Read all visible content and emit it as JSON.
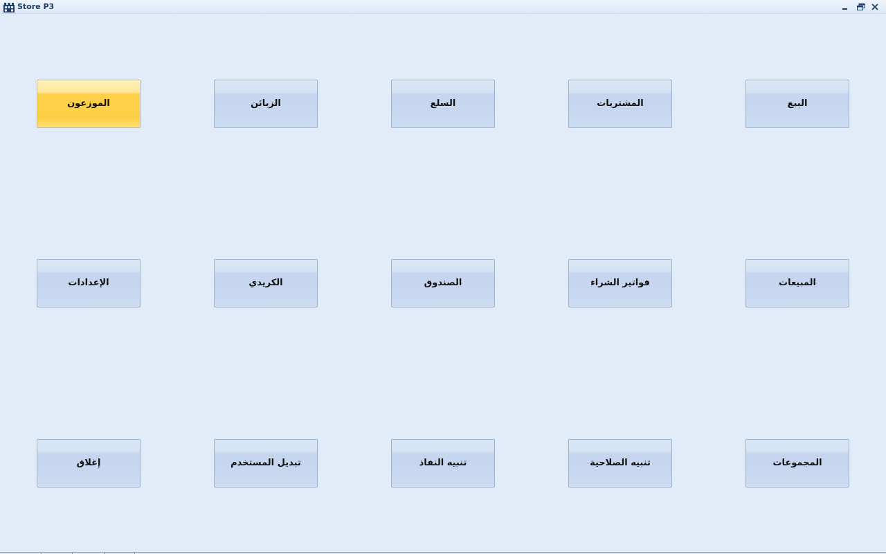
{
  "window": {
    "title": "Store P3"
  },
  "colors": {
    "background": "#e2ecf8",
    "tile": "#c6d7ef",
    "tile_active": "#fdcf45",
    "title_text": "#1f3d66"
  },
  "icons": {
    "app": "app-icon",
    "minimize": "minimize-icon",
    "maximize": "maximize-icon",
    "close": "close-icon"
  },
  "menu": {
    "row1": [
      {
        "label": "البيع"
      },
      {
        "label": "المشتريات"
      },
      {
        "label": "السلع"
      },
      {
        "label": "الزبائن"
      },
      {
        "label": "الموزعون",
        "active": true
      }
    ],
    "row2": [
      {
        "label": "المبيعات"
      },
      {
        "label": "فواتير الشراء"
      },
      {
        "label": "الصندوق"
      },
      {
        "label": "الكريدي"
      },
      {
        "label": "الإعدادات"
      }
    ],
    "row3": [
      {
        "label": "المجموعات"
      },
      {
        "label": "تنبيه الصلاحية"
      },
      {
        "label": "تنبيه النفاذ"
      },
      {
        "label": "تبديل المستخدم"
      },
      {
        "label": "إغلاق"
      }
    ]
  }
}
